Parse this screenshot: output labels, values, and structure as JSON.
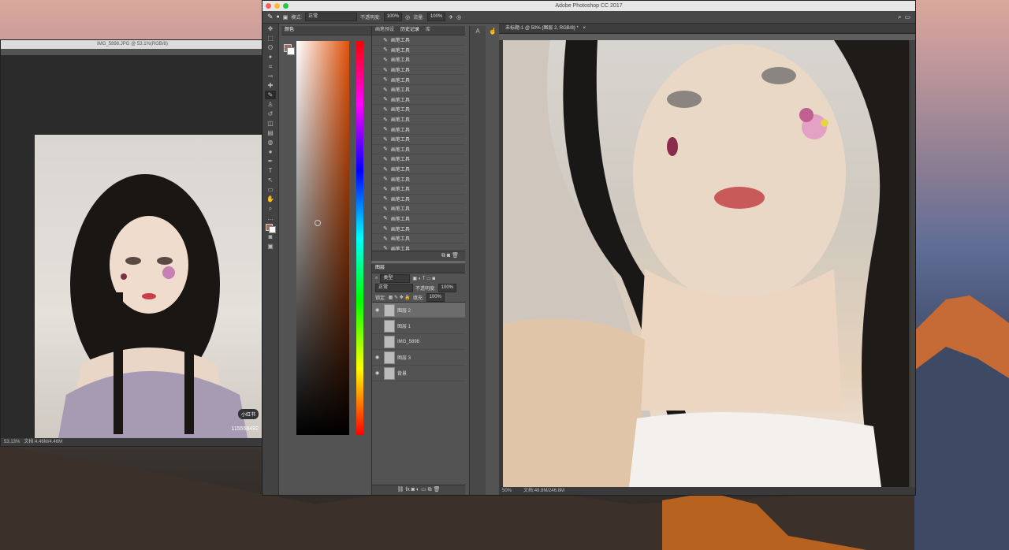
{
  "app": {
    "title": "Adobe Photoshop CC 2017"
  },
  "second_window": {
    "title": "IMG_5898.JPG @ 53.1%(RGB/8)",
    "zoom": "53.13%",
    "doc_info": "文档:4.46M/4.46M",
    "watermark_brand": "小红书",
    "watermark_id": "115558492"
  },
  "options_bar": {
    "mode_label": "模式:",
    "mode_value": "正常",
    "opacity_label": "不透明度:",
    "opacity_value": "100%",
    "flow_label": "流量:",
    "flow_value": "100%"
  },
  "color_panel": {
    "tab": "颜色"
  },
  "history_panel": {
    "tabs": [
      "画笔预设",
      "历史记录",
      "库"
    ],
    "item_label": "画笔工具",
    "item_count": 23
  },
  "layers_panel": {
    "tab": "图层",
    "filter": "类型",
    "blend": "正常",
    "opacity_label": "不透明度:",
    "opacity_value": "100%",
    "lock_label": "锁定:",
    "fill_label": "填充:",
    "fill_value": "100%",
    "layers": [
      {
        "name": "图层 2",
        "visible": true,
        "selected": true
      },
      {
        "name": "图层 1",
        "visible": false,
        "selected": false
      },
      {
        "name": "IMG_5898",
        "visible": false,
        "selected": false
      },
      {
        "name": "图层 3",
        "visible": true,
        "selected": false
      },
      {
        "name": "背景",
        "visible": true,
        "selected": false
      }
    ]
  },
  "document": {
    "tab": "未标题-1 @ 50% (图层 2, RGB/8) *",
    "zoom": "50%",
    "doc_info": "文档:49.8M/246.8M"
  },
  "colors": {
    "accent": "#e0520a",
    "panel": "#535353",
    "dark": "#424242"
  }
}
